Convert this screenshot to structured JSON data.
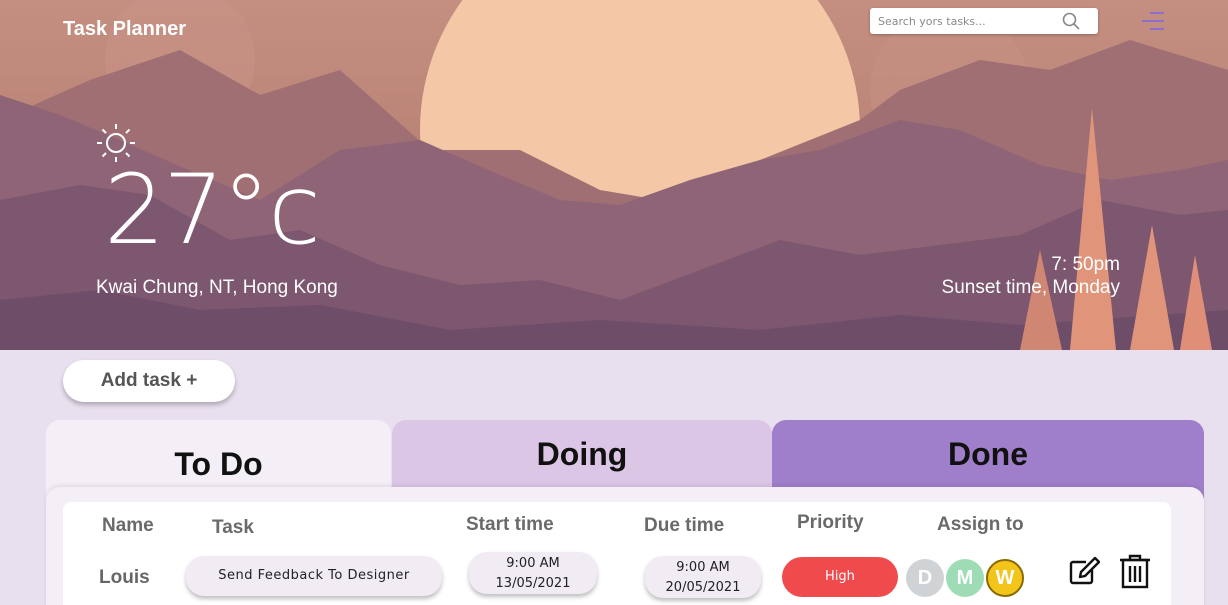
{
  "app": {
    "title": "Task Planner"
  },
  "search": {
    "placeholder": "Search yors tasks..."
  },
  "weather": {
    "temperature": "27°c",
    "location": "Kwai Chung, NT, Hong Kong",
    "sunset_time": "7: 50pm",
    "sunset_label": "Sunset time, Monday",
    "icon": "sun-icon"
  },
  "actions": {
    "add_task_label": "Add task +"
  },
  "tabs": [
    {
      "label": "To Do",
      "active": true
    },
    {
      "label": "Doing",
      "active": false
    },
    {
      "label": "Done",
      "active": false
    }
  ],
  "table": {
    "headers": [
      "Name",
      "Task",
      "Start time",
      "Due time",
      "Priority",
      "Assign to"
    ],
    "rows": [
      {
        "name": "Louis",
        "task": "Send Feedback To Designer",
        "start_time": "9:00 AM",
        "start_date": "13/05/2021",
        "due_time": "9:00 AM",
        "due_date": "20/05/2021",
        "priority": "High",
        "assignees": [
          "D",
          "M",
          "W"
        ],
        "actions": [
          "edit-icon",
          "trash-icon"
        ]
      }
    ]
  },
  "colors": {
    "priority_high": "#ef4a4c",
    "tab_done": "#a07fca",
    "tab_doing": "#dcc6e6",
    "accent": "#8e6fc9"
  }
}
